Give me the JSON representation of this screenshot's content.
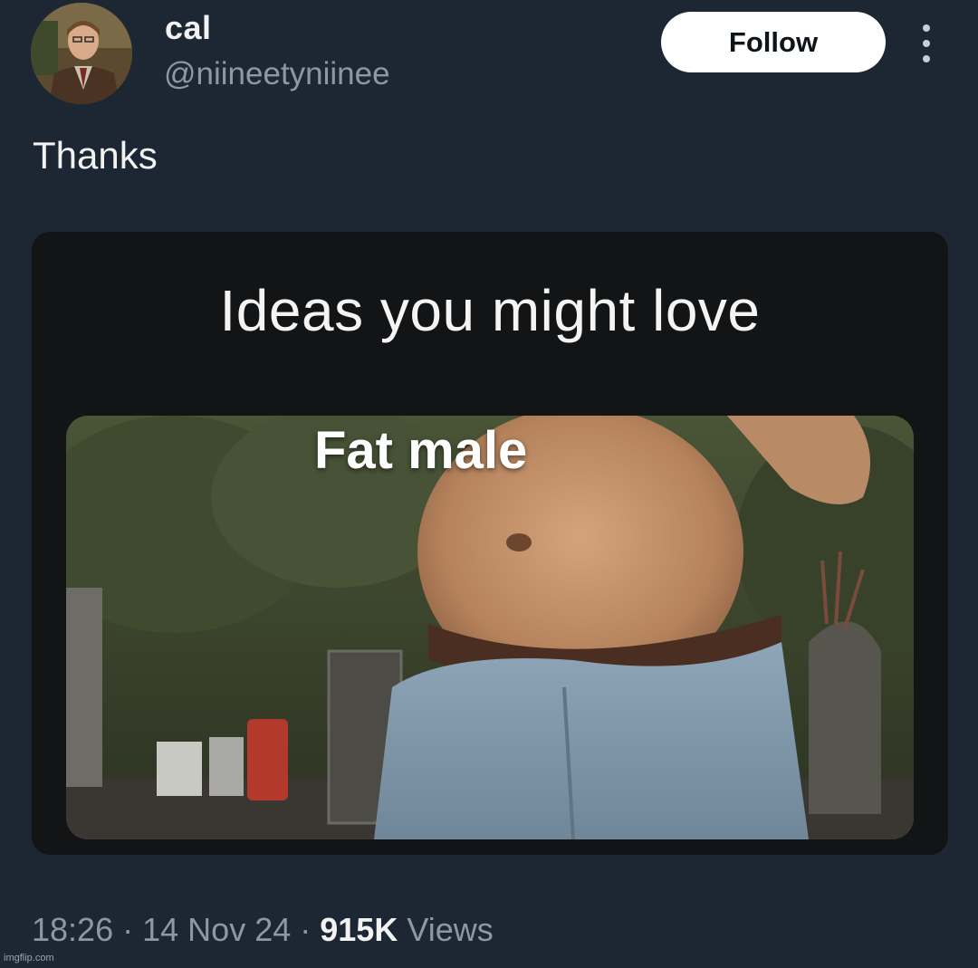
{
  "tweet": {
    "author": {
      "display_name": "cal",
      "handle": "@niineetyniinee",
      "avatar_icon": "profile-photo"
    },
    "follow_label": "Follow",
    "more_icon": "more-dots-icon",
    "text": "Thanks",
    "media": {
      "heading": "Ideas you might love",
      "tile_caption": "Fat male"
    },
    "meta": {
      "time": "18:26",
      "separator": "·",
      "date": "14 Nov 24",
      "views_count": "915K",
      "views_label": "Views"
    }
  },
  "watermark": "imgflip.com",
  "colors": {
    "background": "#1c2733",
    "follow_button_bg": "#ffffff",
    "secondary_text": "#8b98a5",
    "card_bg": "#121416"
  }
}
